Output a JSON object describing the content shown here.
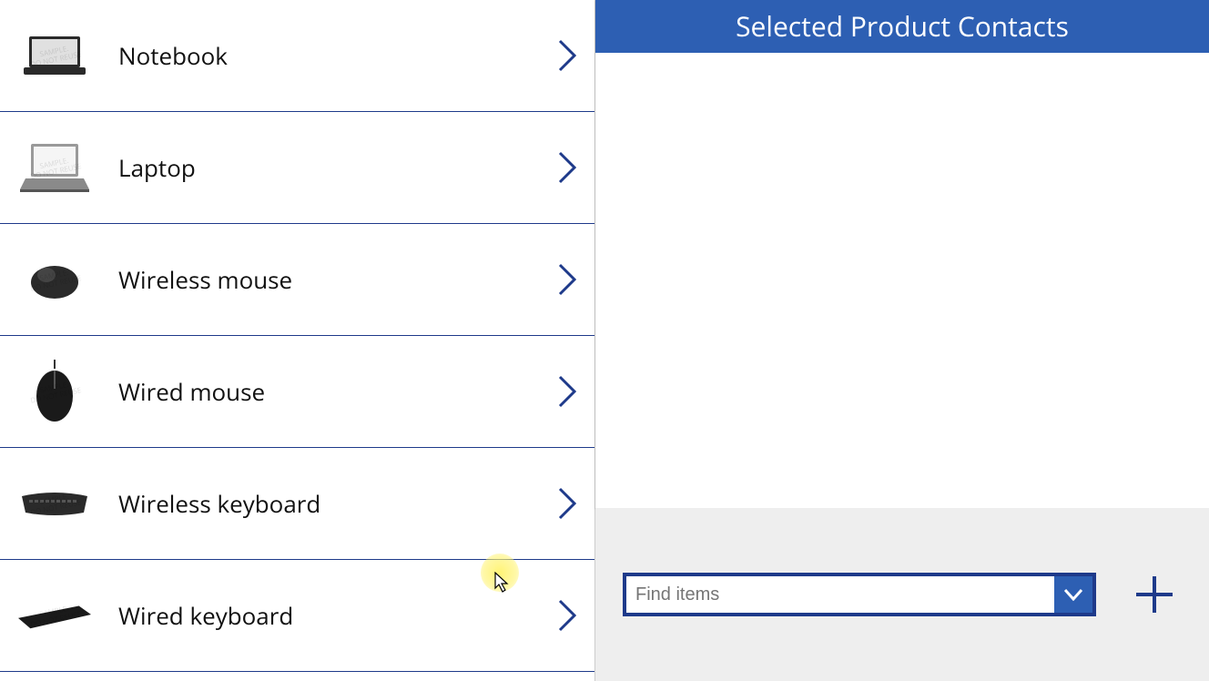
{
  "products": [
    {
      "label": "Notebook",
      "icon": "notebook"
    },
    {
      "label": "Laptop",
      "icon": "laptop"
    },
    {
      "label": "Wireless mouse",
      "icon": "mouse-wireless"
    },
    {
      "label": "Wired mouse",
      "icon": "mouse-wired"
    },
    {
      "label": "Wireless keyboard",
      "icon": "keyboard"
    },
    {
      "label": "Wired keyboard",
      "icon": "keyboard-dark"
    }
  ],
  "right": {
    "header": "Selected Product Contacts",
    "find_placeholder": "Find items"
  },
  "colors": {
    "accent": "#2d5fb3",
    "border": "#1e3a8a"
  }
}
